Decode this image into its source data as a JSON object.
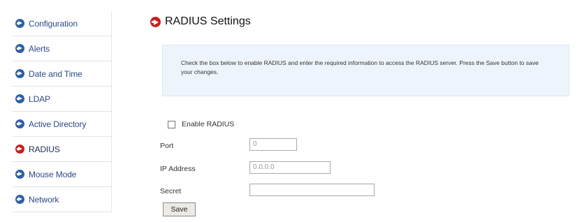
{
  "sidebar": {
    "items": [
      {
        "label": "Configuration",
        "icon": "arrow-circle-icon"
      },
      {
        "label": "Alerts",
        "icon": "arrow-circle-icon"
      },
      {
        "label": "Date and Time",
        "icon": "arrow-circle-icon"
      },
      {
        "label": "LDAP",
        "icon": "arrow-circle-icon"
      },
      {
        "label": "Active Directory",
        "icon": "arrow-circle-icon"
      },
      {
        "label": "RADIUS",
        "icon": "arrow-circle-icon",
        "active": true
      },
      {
        "label": "Mouse Mode",
        "icon": "arrow-circle-icon"
      },
      {
        "label": "Network",
        "icon": "arrow-circle-icon"
      }
    ]
  },
  "main": {
    "title": "RADIUS Settings",
    "info": "Check the box below to enable RADIUS and enter the required information to access the RADIUS server. Press the Save button to save your changes.",
    "enable_label": "Enable RADIUS",
    "enable_checked": false,
    "fields": {
      "port": {
        "label": "Port",
        "value": "0"
      },
      "ip": {
        "label": "IP Address",
        "value": "0.0.0.0"
      },
      "secret": {
        "label": "Secret",
        "value": ""
      }
    },
    "save_label": "Save"
  },
  "colors": {
    "nav_icon": "#2f5fa8",
    "active_icon": "#cc1d1d",
    "info_bg": "#eef4fb",
    "nav_text": "#2b4a86"
  }
}
